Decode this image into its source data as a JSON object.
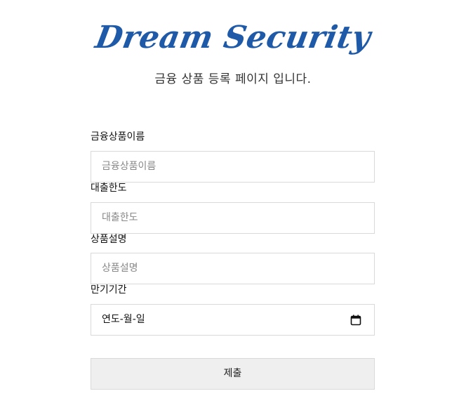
{
  "header": {
    "logo_text": "Dream Security",
    "subtitle": "금융 상품 등록 페이지 입니다."
  },
  "form": {
    "product_name": {
      "label": "금융상품이름",
      "placeholder": "금융상품이름",
      "value": ""
    },
    "loan_limit": {
      "label": "대출한도",
      "placeholder": "대출한도",
      "value": ""
    },
    "description": {
      "label": "상품설명",
      "placeholder": "상품설명",
      "value": ""
    },
    "maturity": {
      "label": "만기기간",
      "placeholder": "연도-월-일",
      "icon": "calendar-icon"
    },
    "submit_label": "제출"
  },
  "colors": {
    "logo": "#1f5aa8",
    "input_border": "#d9d9d9",
    "button_bg": "#efefef"
  }
}
